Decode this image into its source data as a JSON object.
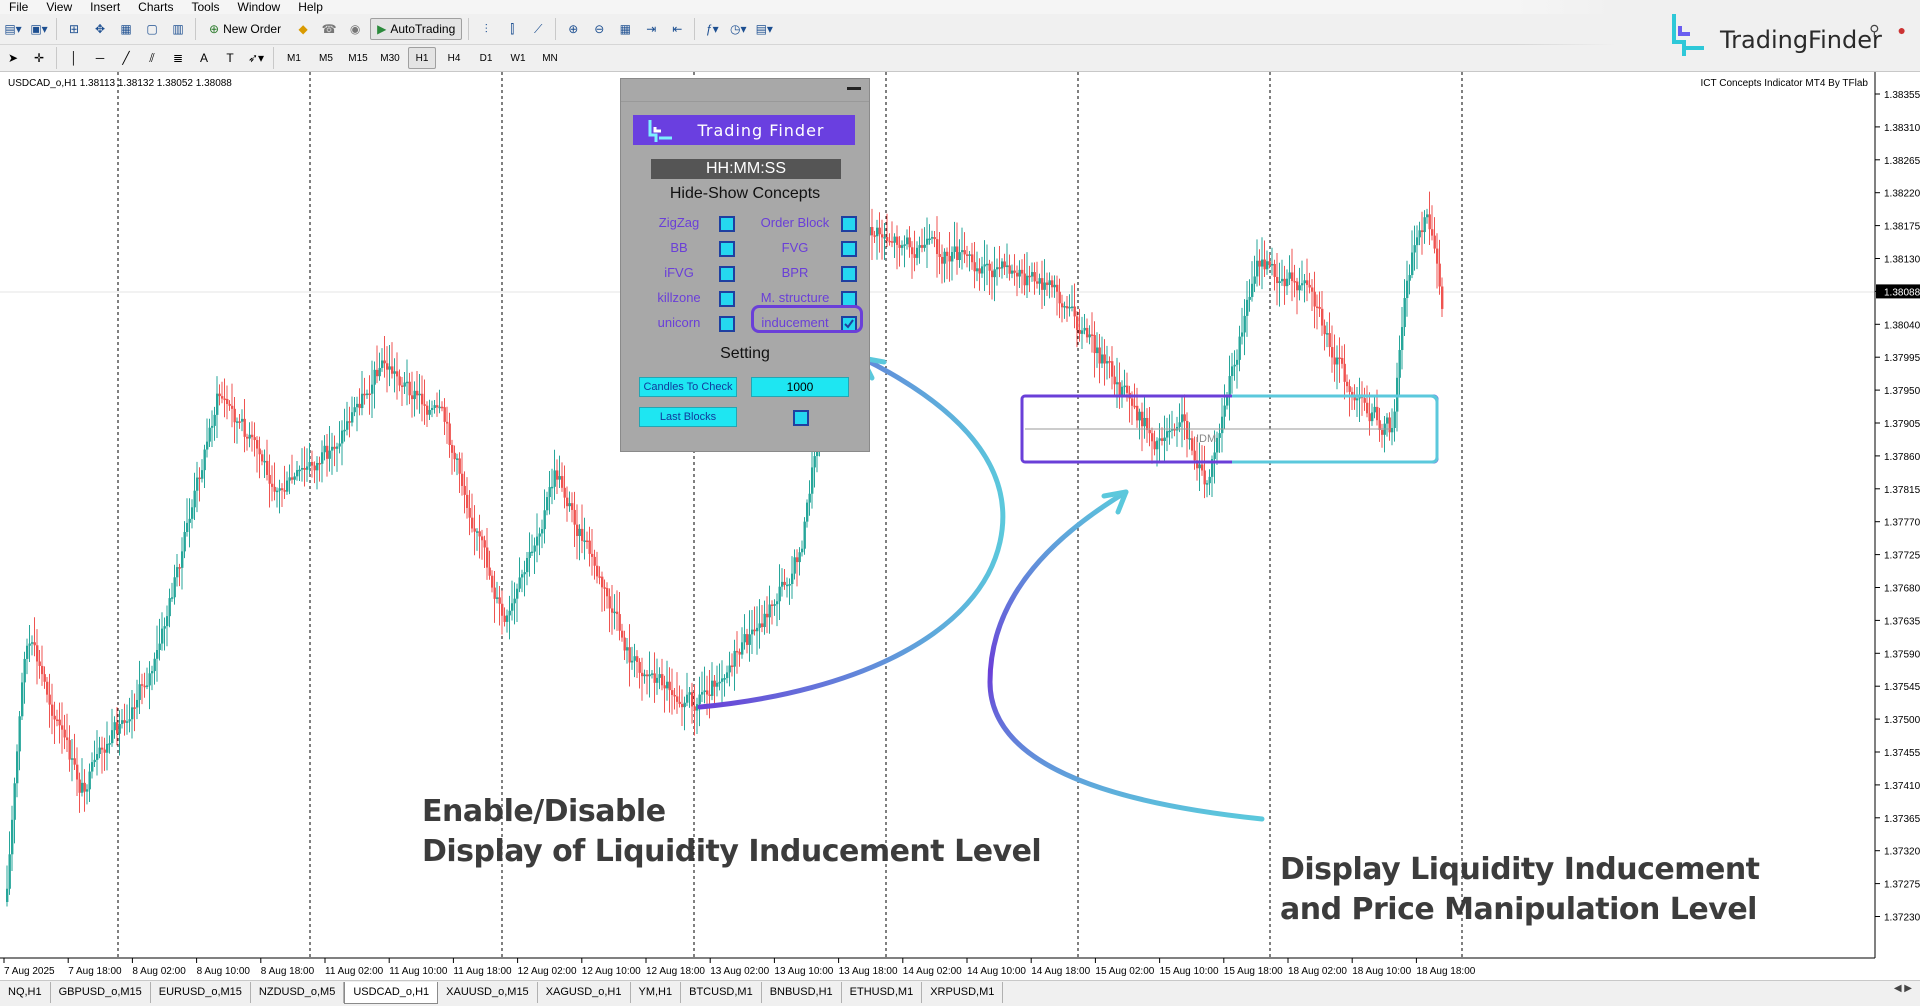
{
  "menu": [
    "File",
    "View",
    "Insert",
    "Charts",
    "Tools",
    "Window",
    "Help"
  ],
  "toolbar": {
    "new_order": "New Order",
    "auto_trading": "AutoTrading",
    "timeframes": [
      "M1",
      "M5",
      "M15",
      "M30",
      "H1",
      "H4",
      "D1",
      "W1",
      "MN"
    ],
    "active_timeframe": "H1"
  },
  "brand": {
    "name": "TradingFinder"
  },
  "chart": {
    "symbol_header": "USDCAD_o,H1  1.38113 1.38132 1.38052 1.38088",
    "indicator_label": "ICT Concepts Indicator MT4 By TFlab",
    "current_price": "1.38088",
    "price_levels": [
      "1.38355",
      "1.38310",
      "1.38265",
      "1.38220",
      "1.38175",
      "1.38130",
      "1.38088",
      "1.38040",
      "1.37995",
      "1.37950",
      "1.37905",
      "1.37860",
      "1.37815",
      "1.37770",
      "1.37725",
      "1.37680",
      "1.37635",
      "1.37590",
      "1.37545",
      "1.37500",
      "1.37455",
      "1.37410",
      "1.37365",
      "1.37320",
      "1.37275",
      "1.37230"
    ],
    "time_labels": [
      "7 Aug 2025",
      "7 Aug 18:00",
      "8 Aug 02:00",
      "8 Aug 10:00",
      "8 Aug 18:00",
      "11 Aug 02:00",
      "11 Aug 10:00",
      "11 Aug 18:00",
      "12 Aug 02:00",
      "12 Aug 10:00",
      "12 Aug 18:00",
      "13 Aug 02:00",
      "13 Aug 10:00",
      "13 Aug 18:00",
      "14 Aug 02:00",
      "14 Aug 10:00",
      "14 Aug 18:00",
      "15 Aug 02:00",
      "15 Aug 10:00",
      "15 Aug 18:00",
      "18 Aug 02:00",
      "18 Aug 10:00",
      "18 Aug 18:00"
    ],
    "idm_label": "IDM",
    "colors": {
      "bull": "#26a69a",
      "bear": "#ef5350",
      "highlight_purple": "#6a3fd8",
      "highlight_cyan": "#5bc8dc"
    }
  },
  "panel": {
    "logo_text": "Trading Finder",
    "time": "HH:MM:SS",
    "concepts_title": "Hide-Show Concepts",
    "checkboxes": [
      {
        "label": "ZigZag",
        "checked": false
      },
      {
        "label": "Order Block",
        "checked": false
      },
      {
        "label": "BB",
        "checked": false
      },
      {
        "label": "FVG",
        "checked": false
      },
      {
        "label": "iFVG",
        "checked": false
      },
      {
        "label": "BPR",
        "checked": false
      },
      {
        "label": "killzone",
        "checked": false
      },
      {
        "label": "M. structure",
        "checked": false
      },
      {
        "label": "unicorn",
        "checked": false
      },
      {
        "label": "inducement",
        "checked": true
      }
    ],
    "setting_title": "Setting",
    "candles_to_check_label": "Candles To Check",
    "candles_to_check_value": "1000",
    "last_blocks_label": "Last Blocks",
    "last_blocks_checked": false
  },
  "annotations": {
    "left_line1": "Enable/Disable",
    "left_line2": "Display of Liquidity Inducement Level",
    "right_line1": "Display Liquidity Inducement",
    "right_line2": "and Price Manipulation Level"
  },
  "symbol_tabs": [
    "NQ,H1",
    "GBPUSD_o,M15",
    "EURUSD_o,M15",
    "NZDUSD_o,M5",
    "USDCAD_o,H1",
    "XAUUSD_o,M15",
    "XAGUSD_o,H1",
    "YM,H1",
    "BTCUSD,M1",
    "BNBUSD,H1",
    "ETHUSD,M1",
    "XRPUSD,M1"
  ],
  "active_symbol_tab": "USDCAD_o,H1"
}
